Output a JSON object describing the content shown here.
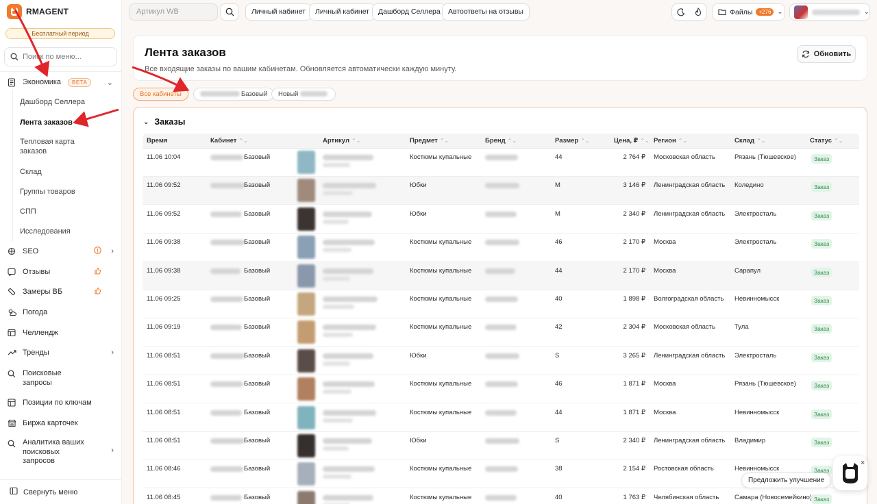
{
  "colors": {
    "accent": "#f07a2c",
    "annotation": "#e0262b",
    "status_green": "#2c8a48"
  },
  "brand": {
    "name": "RMAGENT",
    "logo_icon": "cat-logo-icon"
  },
  "sidebar": {
    "trial_label": "Бесплатный период",
    "search_placeholder": "Поиск по меню...",
    "economics": {
      "label": "Экономика",
      "badge": "BETA"
    },
    "sub_items": [
      "Дашборд Селлера",
      "Лента заказов",
      "Тепловая карта заказов",
      "Склад",
      "Группы товаров",
      "СПП",
      "Исследования"
    ],
    "items": [
      {
        "label": "SEO",
        "icon": "seo-icon"
      },
      {
        "label": "Отзывы",
        "icon": "reviews-icon"
      },
      {
        "label": "Замеры ВБ",
        "icon": "ruler-icon"
      },
      {
        "label": "Погода",
        "icon": "weather-icon"
      },
      {
        "label": "Челлендж",
        "icon": "challenge-icon"
      },
      {
        "label": "Тренды",
        "icon": "trend-icon"
      },
      {
        "label": "Поисковые запросы",
        "icon": "search-queries-icon"
      },
      {
        "label": "Позиции по ключам",
        "icon": "positions-icon"
      },
      {
        "label": "Биржа карточек",
        "icon": "exchange-icon"
      },
      {
        "label": "Аналитика ваших поисковых запросов",
        "icon": "analytics-icon"
      }
    ],
    "collapse_label": "Свернуть меню"
  },
  "topbar": {
    "article_placeholder": "Артикул WB",
    "buttons": [
      "Личный кабинет",
      "Личный кабинет",
      "Дашборд Селлера",
      "Автоответы на отзывы"
    ],
    "files_label": "Файлы",
    "files_count": "+276"
  },
  "header": {
    "title": "Лента заказов",
    "subtitle": "Все входящие заказы по вашим кабинетам. Обновляется автоматически каждую минуту.",
    "refresh_label": "Обновить"
  },
  "filters": {
    "all": "Все кабинеты",
    "chip2_suffix": "Базовый",
    "chip3_prefix": "Новый"
  },
  "orders": {
    "title": "Заказы",
    "columns": [
      "Время",
      "Кабинет",
      "Артикул",
      "Предмет",
      "Бренд",
      "Размер",
      "Цена, ₽",
      "Регион",
      "Склад",
      "Статус"
    ],
    "rows": [
      {
        "time": "11.06 10:04",
        "cabinet": "Базовый",
        "subject": "Костюмы купальные",
        "size": "44",
        "price": "2 764 ₽",
        "region": "Московская область",
        "warehouse": "Рязань (Тюшевское)",
        "status": "Заказ",
        "thumb": "#8fb7c4"
      },
      {
        "time": "11.06 09:52",
        "cabinet": "Базовый",
        "subject": "Юбки",
        "size": "M",
        "price": "3 146 ₽",
        "region": "Ленинградская область",
        "warehouse": "Коледино",
        "status": "Заказ",
        "thumb": "#a08a7c"
      },
      {
        "time": "11.06 09:52",
        "cabinet": "Базовый",
        "subject": "Юбки",
        "size": "M",
        "price": "2 340 ₽",
        "region": "Ленинградская область",
        "warehouse": "Электросталь",
        "status": "Заказ",
        "thumb": "#3b3431"
      },
      {
        "time": "11.06 09:38",
        "cabinet": "Базовый",
        "subject": "Костюмы купальные",
        "size": "46",
        "price": "2 170 ₽",
        "region": "Москва",
        "warehouse": "Электросталь",
        "status": "Заказ",
        "thumb": "#8aa0b6"
      },
      {
        "time": "11.06 09:38",
        "cabinet": "Базовый",
        "subject": "Костюмы купальные",
        "size": "44",
        "price": "2 170 ₽",
        "region": "Москва",
        "warehouse": "Сарапул",
        "status": "Заказ",
        "thumb": "#8a98ab"
      },
      {
        "time": "11.06 09:25",
        "cabinet": "Базовый",
        "subject": "Костюмы купальные",
        "size": "40",
        "price": "1 898 ₽",
        "region": "Волгоградская область",
        "warehouse": "Невинномысск",
        "status": "Заказ",
        "thumb": "#c5a77f"
      },
      {
        "time": "11.06 09:19",
        "cabinet": "Базовый",
        "subject": "Костюмы купальные",
        "size": "42",
        "price": "2 304 ₽",
        "region": "Московская область",
        "warehouse": "Тула",
        "status": "Заказ",
        "thumb": "#c49c72"
      },
      {
        "time": "11.06 08:51",
        "cabinet": "Базовый",
        "subject": "Юбки",
        "size": "S",
        "price": "3 265 ₽",
        "region": "Ленинградская область",
        "warehouse": "Электросталь",
        "status": "Заказ",
        "thumb": "#5a4c48"
      },
      {
        "time": "11.06 08:51",
        "cabinet": "Базовый",
        "subject": "Костюмы купальные",
        "size": "46",
        "price": "1 871 ₽",
        "region": "Москва",
        "warehouse": "Рязань (Тюшевское)",
        "status": "Заказ",
        "thumb": "#b08060"
      },
      {
        "time": "11.06 08:51",
        "cabinet": "Базовый",
        "subject": "Костюмы купальные",
        "size": "44",
        "price": "1 871 ₽",
        "region": "Москва",
        "warehouse": "Невинномысск",
        "status": "Заказ",
        "thumb": "#7fb3bd"
      },
      {
        "time": "11.06 08:51",
        "cabinet": "Базовый",
        "subject": "Юбки",
        "size": "S",
        "price": "2 340 ₽",
        "region": "Ленинградская область",
        "warehouse": "Владимир",
        "status": "Заказ",
        "thumb": "#35302e"
      },
      {
        "time": "11.06 08:46",
        "cabinet": "Базовый",
        "subject": "Костюмы купальные",
        "size": "38",
        "price": "2 154 ₽",
        "region": "Ростовская область",
        "warehouse": "Невинномысск",
        "status": "Заказ",
        "thumb": "#a6b0bb"
      },
      {
        "time": "11.06 08:45",
        "cabinet": "Базовый",
        "subject": "Костюмы купальные",
        "size": "40",
        "price": "1 763 ₽",
        "region": "Челябинская область",
        "warehouse": "Самара (Новосемейкино)",
        "status": "Заказ",
        "thumb": "#8c7a6e"
      }
    ]
  },
  "floating": {
    "suggest_label": "Предложить улучшение",
    "close_glyph": "×"
  }
}
